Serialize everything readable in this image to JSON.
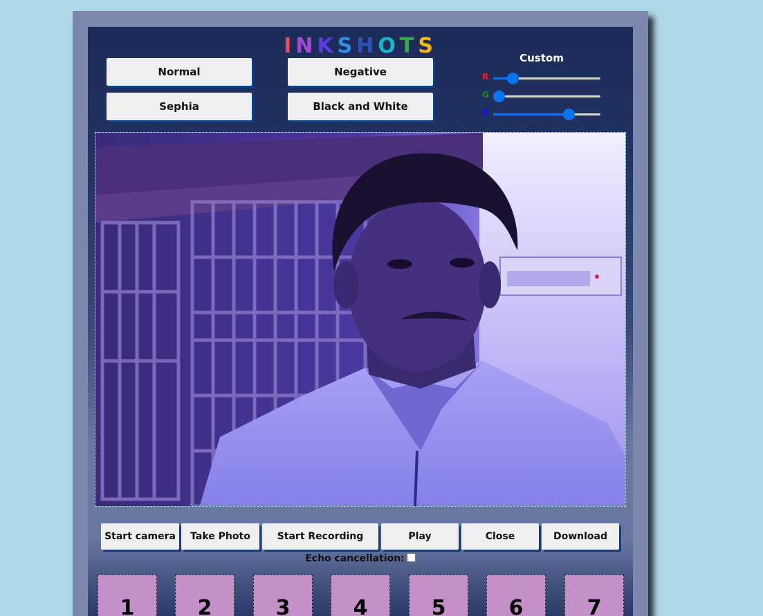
{
  "logo": {
    "letters": [
      "I",
      "N",
      "K",
      "S",
      "H",
      "O",
      "T",
      "S"
    ],
    "colors": [
      "#e94b58",
      "#a14bd3",
      "#5c3ce0",
      "#2f8de4",
      "#2d52b8",
      "#16b6c9",
      "#3aa64a",
      "#f5b51c"
    ]
  },
  "filters": {
    "normal": "Normal",
    "negative": "Negative",
    "sephia": "Sephia",
    "black_white": "Black and White"
  },
  "custom": {
    "title": "Custom",
    "r_label": "R",
    "g_label": "G",
    "b_label": "B",
    "r_value": 0.18,
    "g_value": 0.05,
    "b_value": 0.7,
    "r_color": "#e8202a",
    "g_color": "#1a8a1a",
    "b_color": "#1010e0"
  },
  "controls": {
    "start_camera": "Start camera",
    "take_photo": "Take Photo",
    "start_recording": "Start Recording",
    "play": "Play",
    "close": "Close",
    "download": "Download"
  },
  "echo": {
    "label": "Echo cancellation:",
    "checked": false
  },
  "slots": [
    "1",
    "2",
    "3",
    "4",
    "5",
    "6",
    "7"
  ],
  "colors": {
    "page_bg": "#add8e6",
    "button_shadow": "#0d3f86",
    "slot_bg": "#c58fca"
  }
}
